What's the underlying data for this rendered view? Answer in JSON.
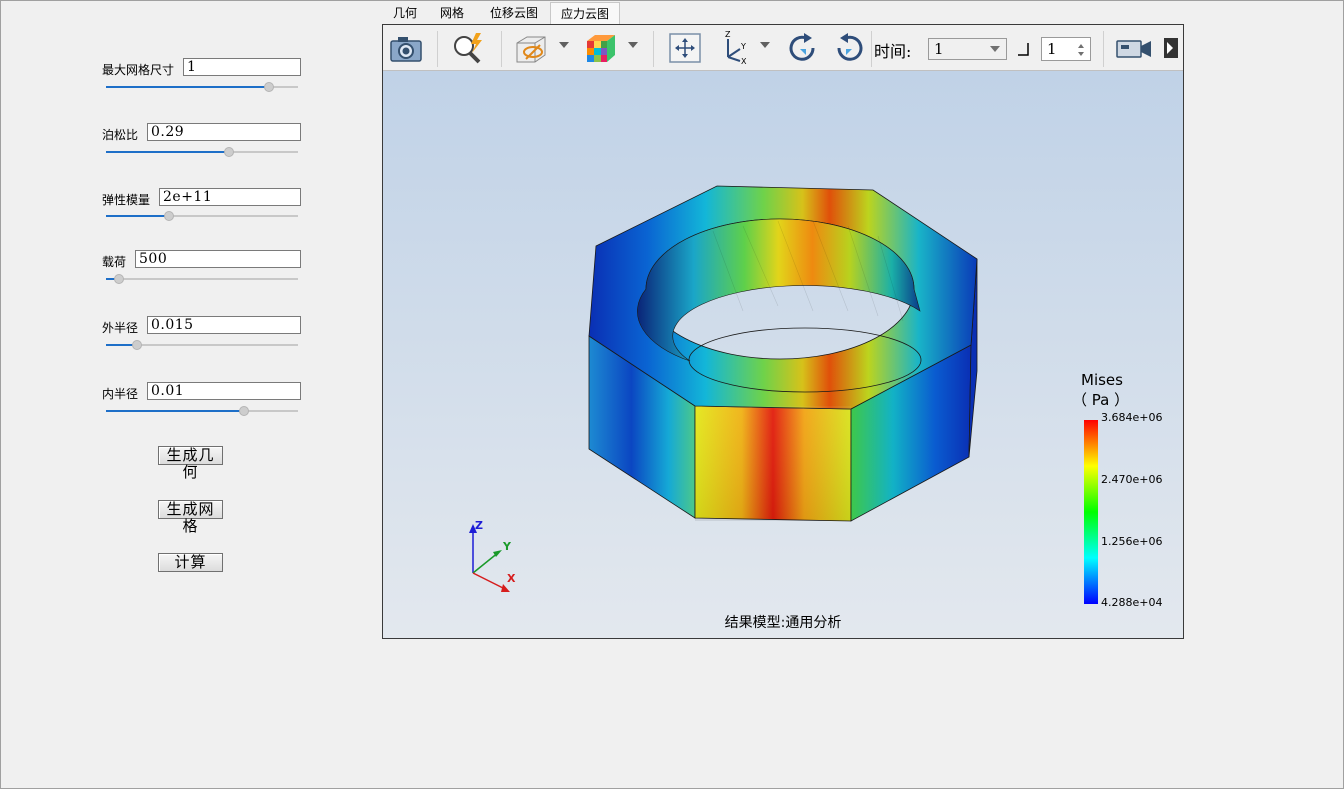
{
  "params": [
    {
      "label": "最大网格尺寸",
      "value": "1",
      "slider_fraction": 0.85
    },
    {
      "label": "泊松比",
      "value": "0.29",
      "slider_fraction": 0.64
    },
    {
      "label": "弹性模量",
      "value": "2e+11",
      "slider_fraction": 0.33
    },
    {
      "label": "载荷",
      "value": "500",
      "slider_fraction": 0.07
    },
    {
      "label": "外半径",
      "value": "0.015",
      "slider_fraction": 0.16
    },
    {
      "label": "内半径",
      "value": "0.01",
      "slider_fraction": 0.72
    }
  ],
  "buttons": {
    "generate_geometry": "生成几何",
    "generate_mesh": "生成网格",
    "compute": "计算"
  },
  "tabs": [
    {
      "label": "几何",
      "active": false
    },
    {
      "label": "网格",
      "active": false
    },
    {
      "label": "位移云图",
      "active": false
    },
    {
      "label": "应力云图",
      "active": true
    }
  ],
  "toolbar": {
    "time_label": "时间:",
    "time_value": "1",
    "step_value": "1",
    "icons": [
      "camera-icon",
      "zoom-fit-icon",
      "display-mode-icon",
      "color-cube-icon",
      "pan-icon",
      "axes-view-icon",
      "rotate-cw-icon",
      "rotate-ccw-icon",
      "video-camera-icon",
      "expand-icon"
    ]
  },
  "legend": {
    "title": "Mises",
    "unit": "（ Pa ）",
    "ticks": [
      "3.684e+06",
      "2.470e+06",
      "1.256e+06",
      "4.288e+04"
    ],
    "colors": [
      "#ff0000",
      "#ffff00",
      "#00ff00",
      "#00ffff",
      "#0000ff"
    ]
  },
  "axes": {
    "x": "X",
    "y": "Y",
    "z": "Z"
  },
  "caption": "结果模型:通用分析"
}
